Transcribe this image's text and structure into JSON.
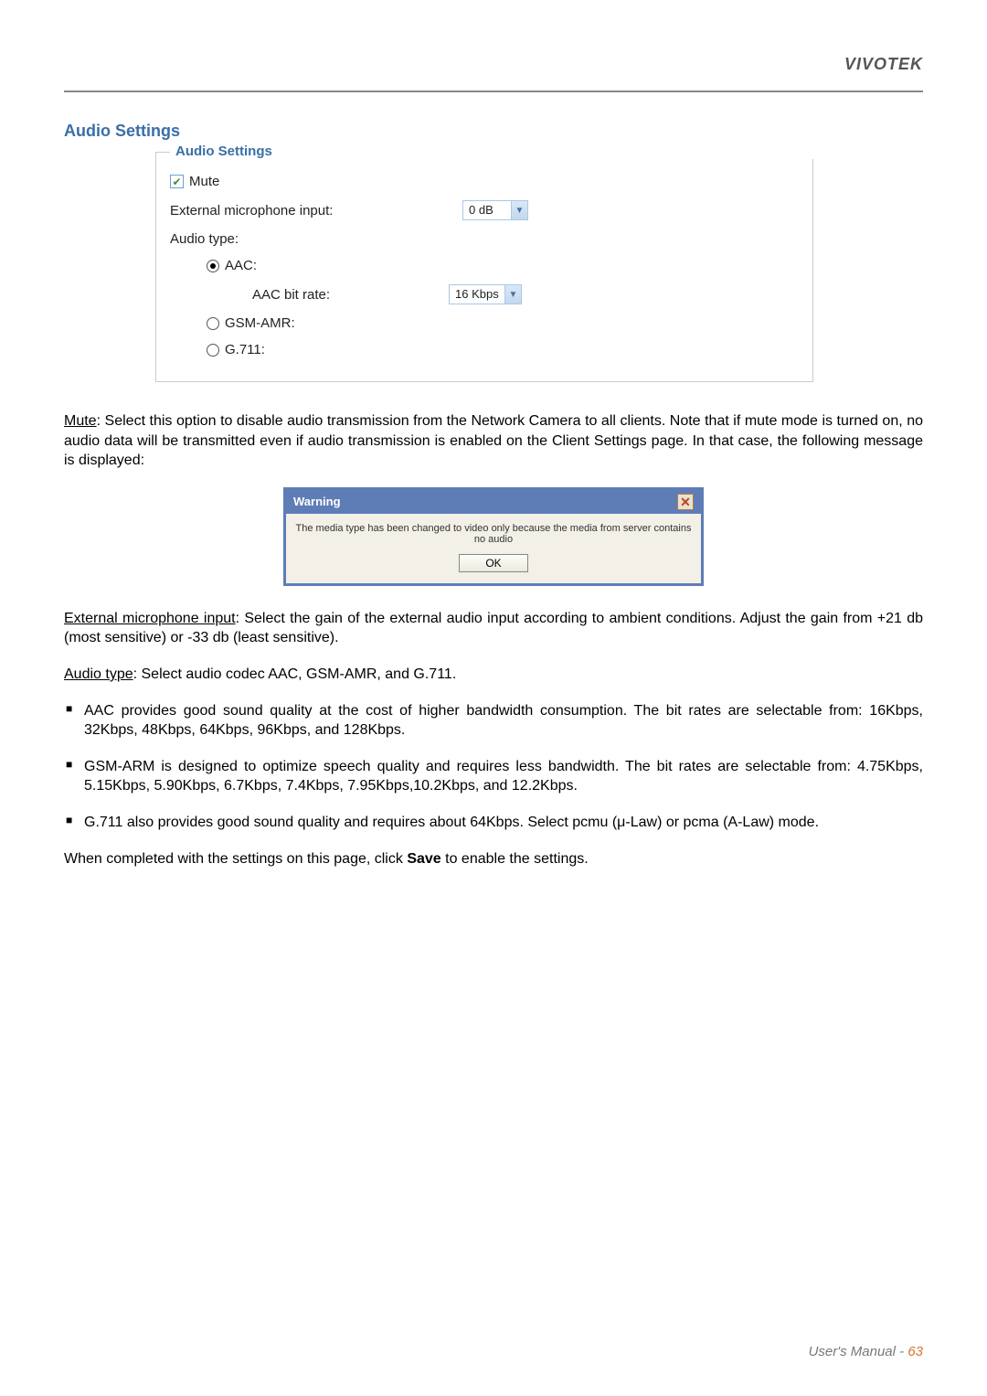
{
  "brand": "VIVOTEK",
  "sectionTitle": "Audio Settings",
  "fieldset": {
    "legend": "Audio Settings",
    "muteLabel": "Mute",
    "muteChecked": "✔",
    "extMicLabel": "External microphone input:",
    "extMicValue": "0 dB",
    "audioTypeLabel": "Audio type:",
    "aacLabel": "AAC:",
    "aacBitRateLabel": "AAC bit rate:",
    "aacBitRateValue": "16 Kbps",
    "gsmLabel": "GSM-AMR:",
    "g711Label": "G.711:"
  },
  "paragraphs": {
    "mute": {
      "label": "Mute",
      "text": ": Select this option to disable audio transmission from the Network Camera to all clients. Note that if mute mode is turned on, no audio data will be transmitted even if audio transmission is enabled on the Client Settings page. In that case, the following message is displayed:"
    },
    "extMic": {
      "label": "External microphone input",
      "text": ": Select the gain of the external audio input according to ambient conditions. Adjust the gain from +21 db (most sensitive) or -33 db (least sensitive)."
    },
    "audioType": {
      "label": "Audio type",
      "text": ": Select audio codec AAC, GSM-AMR, and G.711."
    }
  },
  "bullets": {
    "aac": "AAC provides good sound quality at the cost of higher bandwidth consumption. The bit rates are selectable from: 16Kbps, 32Kbps, 48Kbps, 64Kbps, 96Kbps, and 128Kbps.",
    "gsm": "GSM-ARM is designed to optimize speech quality and requires less bandwidth. The bit rates are selectable from: 4.75Kbps, 5.15Kbps, 5.90Kbps, 6.7Kbps, 7.4Kbps, 7.95Kbps,10.2Kbps, and 12.2Kbps.",
    "g711": "G.711 also provides good sound quality and requires about 64Kbps. Select pcmu (μ-Law) or pcma (A-Law) mode."
  },
  "finalPara": {
    "pre": "When completed with the settings on this page, click ",
    "bold": "Save",
    "post": " to enable the settings."
  },
  "warning": {
    "title": "Warning",
    "closeGlyph": "✕",
    "message": "The media type has been changed to video only because the media from server contains no audio",
    "ok": "OK"
  },
  "footer": {
    "text": "User's Manual - ",
    "page": "63"
  }
}
